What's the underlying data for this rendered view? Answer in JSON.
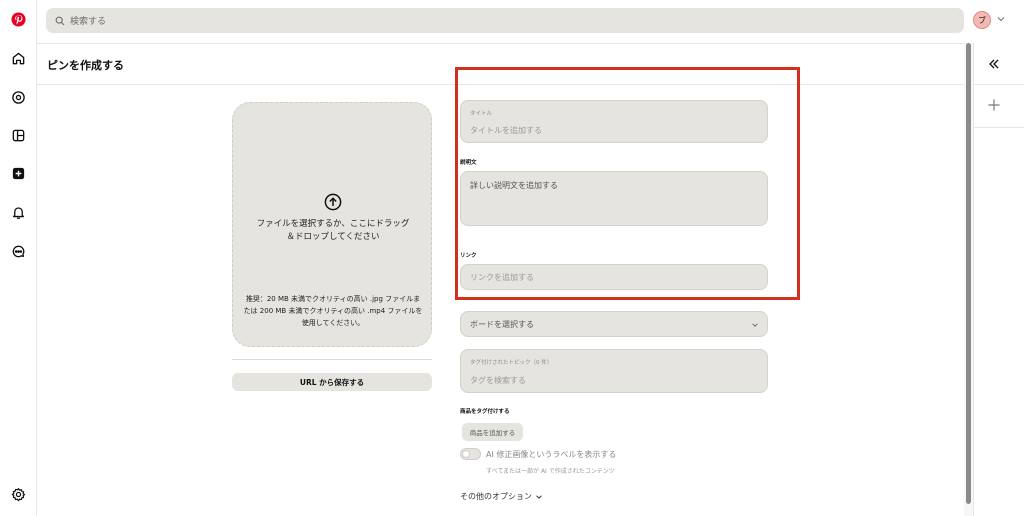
{
  "search": {
    "placeholder": "検索する"
  },
  "avatar": {
    "initial": "ブ"
  },
  "page": {
    "title": "ピンを作成する"
  },
  "upload": {
    "main_text": "ファイルを選択するか、ここにドラッグ＆ドロップしてください",
    "recommendation": "推奨：20 MB 未満でクオリティの高い .jpg ファイルまたは 200 MB 未満でクオリティの高い .mp4 ファイルを使用してください。",
    "url_button": "URL から保存する"
  },
  "form": {
    "title_label": "タイトル",
    "title_placeholder": "タイトルを追加する",
    "description_label": "説明文",
    "description_placeholder": "詳しい説明文を追加する",
    "link_label": "リンク",
    "link_placeholder": "リンクを追加する",
    "board_placeholder": "ボードを選択する",
    "tags_label": "タグ付けされたトピック（0 件）",
    "tags_placeholder": "タグを検索する",
    "products_label": "商品をタグ付けする",
    "add_product_button": "商品を追加する",
    "ai_toggle_label": "AI 修正画像というラベルを表示する",
    "ai_toggle_sub": "すべてまたは一部が AI で作成されたコンテンツ",
    "more_options": "その他のオプション"
  },
  "colors": {
    "brand": "#e60023",
    "field_bg": "#e6e4df",
    "annotation": "#d0311f"
  },
  "icons": {
    "rail": [
      "pinterest-logo-icon",
      "home-icon",
      "explore-icon",
      "dashboard-icon",
      "create-icon",
      "notifications-icon",
      "messages-icon",
      "settings-icon"
    ],
    "right_rail": [
      "collapse-icon",
      "add-icon"
    ]
  }
}
